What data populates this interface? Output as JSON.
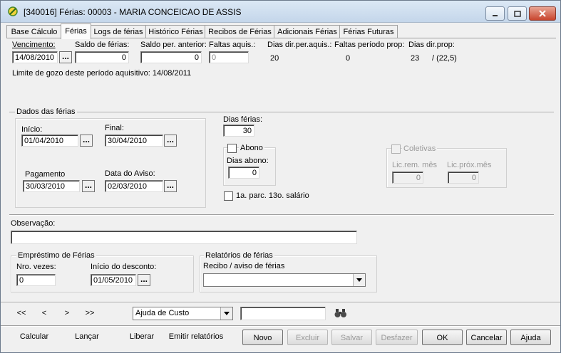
{
  "window": {
    "title": "[340016]  Férias: 00003 - MARIA CONCEICAO DE ASSIS"
  },
  "tabs": [
    {
      "label": "Base Cálculo"
    },
    {
      "label": "Férias"
    },
    {
      "label": "Logs de férias"
    },
    {
      "label": "Histórico Férias"
    },
    {
      "label": "Recibos de Férias"
    },
    {
      "label": "Adicionais Férias"
    },
    {
      "label": "Férias Futuras"
    }
  ],
  "top": {
    "vencimento_label": "Vencimento:",
    "vencimento_value": "14/08/2010",
    "saldo_ferias_label": "Saldo de férias:",
    "saldo_ferias_value": "0",
    "saldo_anterior_label": "Saldo per. anterior:",
    "saldo_anterior_value": "0",
    "faltas_aquis_label": "Faltas aquis.:",
    "faltas_aquis_value": "0",
    "dias_dir_aquis_label": "Dias dir.per.aquis.:",
    "dias_dir_aquis_value": "20",
    "faltas_prop_label": "Faltas período prop:",
    "faltas_prop_value": "0",
    "dias_dir_prop_label": "Dias dir.prop:",
    "dias_dir_prop_value": "23",
    "dias_dir_prop_extra": "/ (22,5)",
    "limite_text": "Limite de gozo deste período aquisitivo: 14/08/2011"
  },
  "dados": {
    "group_title": "Dados das férias",
    "inicio_label": "Início:",
    "inicio_value": "01/04/2010",
    "final_label": "Final:",
    "final_value": "30/04/2010",
    "pagamento_label": "Pagamento",
    "pagamento_value": "30/03/2010",
    "data_aviso_label": "Data do Aviso:",
    "data_aviso_value": "02/03/2010",
    "dias_ferias_label": "Dias férias:",
    "dias_ferias_value": "30",
    "abono_label": "Abono",
    "dias_abono_label": "Dias abono:",
    "dias_abono_value": "0",
    "parc13_label": "1a. parc. 13o. salário",
    "coletivas_label": "Coletivas",
    "lic_rem_label": "Lic.rem. mês",
    "lic_rem_value": "0",
    "lic_prox_label": "Lic.próx.mês",
    "lic_prox_value": "0"
  },
  "observacao": {
    "label": "Observação:",
    "value": ""
  },
  "emprestimo": {
    "group_title": "Empréstimo de Férias",
    "nro_vezes_label": "Nro. vezes:",
    "nro_vezes_value": "0",
    "inicio_desconto_label": "Início do desconto:",
    "inicio_desconto_value": "01/05/2010"
  },
  "relatorios": {
    "group_title": "Relatórios de férias",
    "recibo_label": "Recibo / aviso de férias",
    "recibo_value": ""
  },
  "nav": {
    "first": "<<",
    "prev": "<",
    "next": ">",
    "last": ">>",
    "combo_value": "Ajuda de Custo",
    "search_value": ""
  },
  "buttons": {
    "calcular": "Calcular",
    "lancar": "Lançar",
    "liberar": "Liberar",
    "emitir": "Emitir relatórios",
    "novo": "Novo",
    "excluir": "Excluir",
    "salvar": "Salvar",
    "desfazer": "Desfazer",
    "ok": "OK",
    "cancelar": "Cancelar",
    "ajuda": "Ajuda"
  },
  "colors": {
    "window_bg": "#f0f0f0",
    "titlebar": "#c4d6ea",
    "close_button": "#c8452e"
  },
  "icons": [
    "app-icon",
    "minimize-icon",
    "maximize-icon",
    "close-icon",
    "ellipsis-icon",
    "dropdown-arrow-icon",
    "binoculars-icon"
  ]
}
